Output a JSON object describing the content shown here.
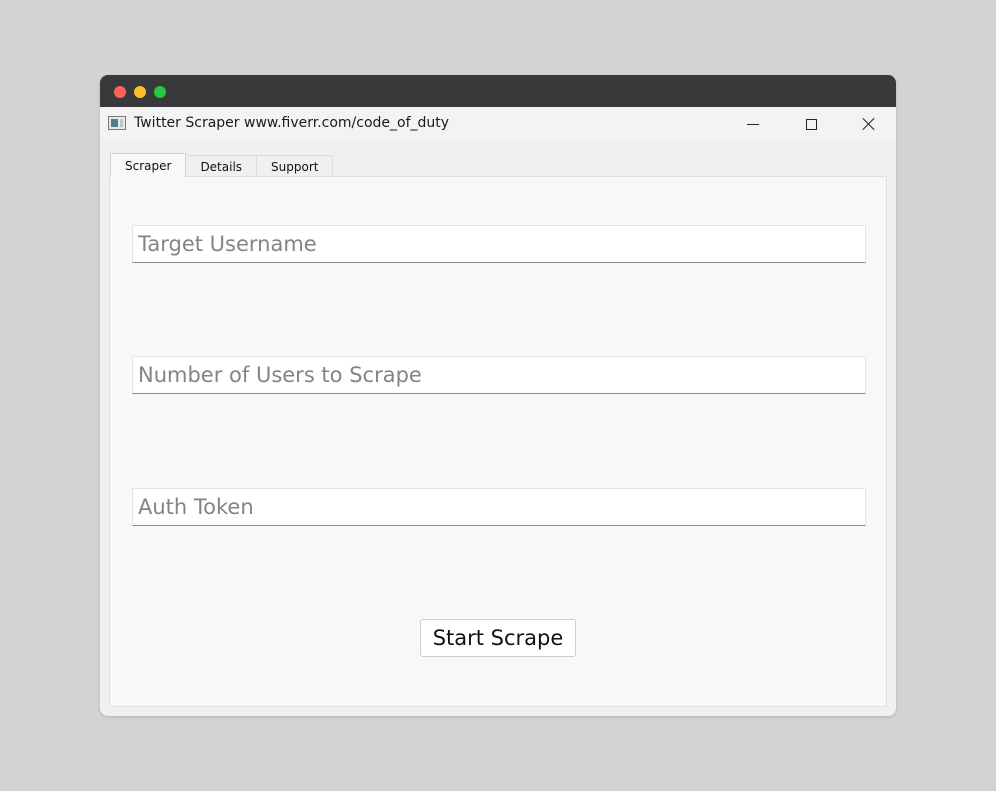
{
  "window": {
    "title": "Twitter Scraper www.fiverr.com/code_of_duty",
    "icon": "app-window-icon"
  },
  "tabs": [
    {
      "label": "Scraper",
      "active": true
    },
    {
      "label": "Details",
      "active": false
    },
    {
      "label": "Support",
      "active": false
    }
  ],
  "form": {
    "target_username": {
      "placeholder": "Target Username",
      "value": ""
    },
    "num_users": {
      "placeholder": "Number of Users to Scrape",
      "value": ""
    },
    "auth_token": {
      "placeholder": "Auth Token",
      "value": ""
    },
    "start_label": "Start Scrape"
  },
  "colors": {
    "background": "#d3d3d3",
    "mac_bar": "#38393b",
    "traffic_red": "#fe5f57",
    "traffic_yellow": "#febc2e",
    "traffic_green": "#28c840"
  }
}
